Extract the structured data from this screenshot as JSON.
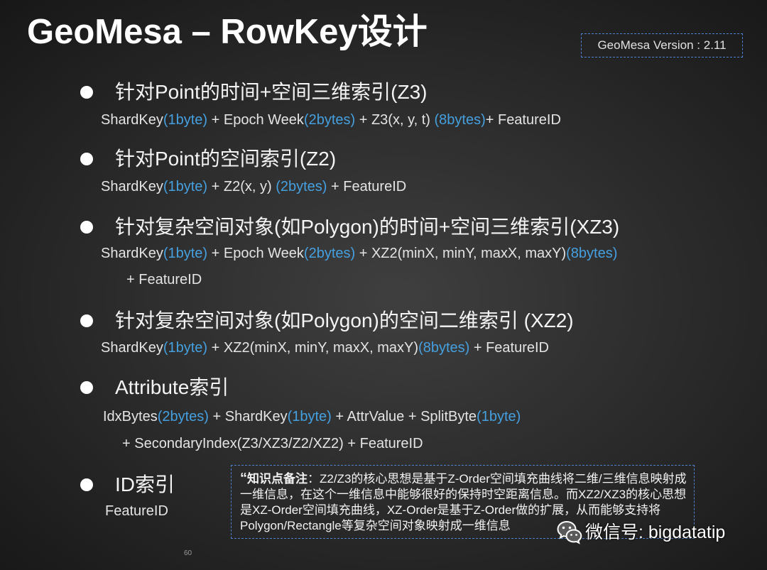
{
  "slide": {
    "title": "GeoMesa – RowKey设计",
    "version": "GeoMesa Version : 2.11",
    "page_number": "60"
  },
  "sections": [
    {
      "heading": "针对Point的时间+空间三维索引(Z3)",
      "lines": [
        [
          "ShardKey",
          "(1byte)",
          " + Epoch Week",
          "(2bytes)",
          " + Z3(x, y, t) ",
          "(8bytes)",
          "+ FeatureID"
        ]
      ]
    },
    {
      "heading": "针对Point的空间索引(Z2)",
      "lines": [
        [
          "ShardKey",
          "(1byte)",
          " + Z2(x, y) ",
          "(2bytes)",
          " + FeatureID"
        ]
      ]
    },
    {
      "heading": "针对复杂空间对象(如Polygon)的时间+空间三维索引(XZ3)",
      "lines": [
        [
          "ShardKey",
          "(1byte)",
          " + Epoch Week",
          "(2bytes)",
          " + XZ2(minX, minY, maxX, maxY)",
          "(8bytes)"
        ],
        [
          "+ FeatureID"
        ]
      ]
    },
    {
      "heading": "针对复杂空间对象(如Polygon)的空间二维索引 (XZ2)",
      "lines": [
        [
          "ShardKey",
          "(1byte)",
          " + XZ2(minX, minY, maxX, maxY)",
          "(8bytes)",
          " + FeatureID"
        ]
      ]
    },
    {
      "heading": "Attribute索引",
      "lines": [
        [
          "IdxBytes",
          "(2bytes)",
          " + ShardKey",
          "(1byte)",
          " + AttrValue + SplitByte",
          "(1byte)"
        ],
        [
          "+ SecondaryIndex(Z3/XZ3/Z2/XZ2) + FeatureID"
        ]
      ]
    },
    {
      "heading": "ID索引",
      "lines": [
        [
          "FeatureID"
        ]
      ]
    }
  ],
  "note": {
    "quote": "“",
    "label": "知识点备注",
    "colon": "：",
    "text": "Z2/Z3的核心思想是基于Z-Order空间填充曲线将二维/三维信息映射成一维信息，在这个一维信息中能够很好的保持时空距离信息。而XZ2/XZ3的核心思想是XZ-Order空间填充曲线，XZ-Order是基于Z-Order做的扩展，从而能够支持将Polygon/Rectangle等复杂空间对象映射成一维信息"
  },
  "watermark": {
    "icon": "wechat-icon",
    "text": "微信号: bigdatatip"
  },
  "colors": {
    "background": "#2d2d2d",
    "heading_text": "#f4f4f4",
    "body_text": "#e4e4e4",
    "highlight": "#45a0e0",
    "border": "#4f82cc"
  }
}
